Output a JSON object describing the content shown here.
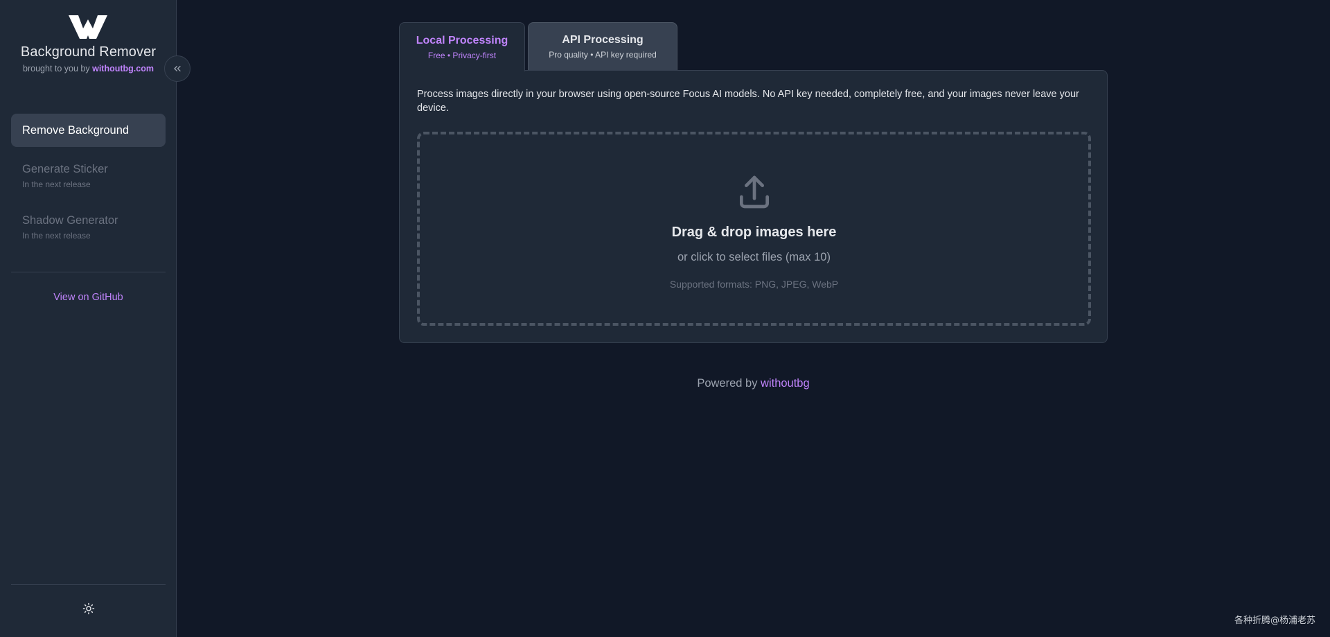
{
  "sidebar": {
    "brand_title": "Background Remover",
    "brand_sub_prefix": "brought to you by ",
    "brand_sub_link": "withoutbg.com",
    "nav": {
      "active": "Remove Background",
      "items": [
        {
          "label": "Generate Sticker",
          "note": "In the next release"
        },
        {
          "label": "Shadow Generator",
          "note": "In the next release"
        }
      ]
    },
    "github_link": "View on GitHub",
    "collapse_icon": "double-chevron-left-icon",
    "theme_icon": "sun-icon"
  },
  "tabs": [
    {
      "label": "Local Processing",
      "sub": "Free • Privacy-first",
      "active": true
    },
    {
      "label": "API Processing",
      "sub": "Pro quality • API key required",
      "active": false
    }
  ],
  "card": {
    "description": "Process images directly in your browser using open-source Focus AI models. No API key needed, completely free, and your images never leave your device.",
    "dropzone": {
      "icon": "upload-icon",
      "title": "Drag & drop images here",
      "subtitle": "or click to select files (max 10)",
      "formats": "Supported formats: PNG, JPEG, WebP"
    }
  },
  "footer": {
    "prefix": "Powered by ",
    "link": "withoutbg"
  },
  "watermark": "各种折腾@杨浦老苏",
  "colors": {
    "background": "#111827",
    "sidebar": "#1f2937",
    "accent": "#c084fc",
    "border": "#374151"
  }
}
